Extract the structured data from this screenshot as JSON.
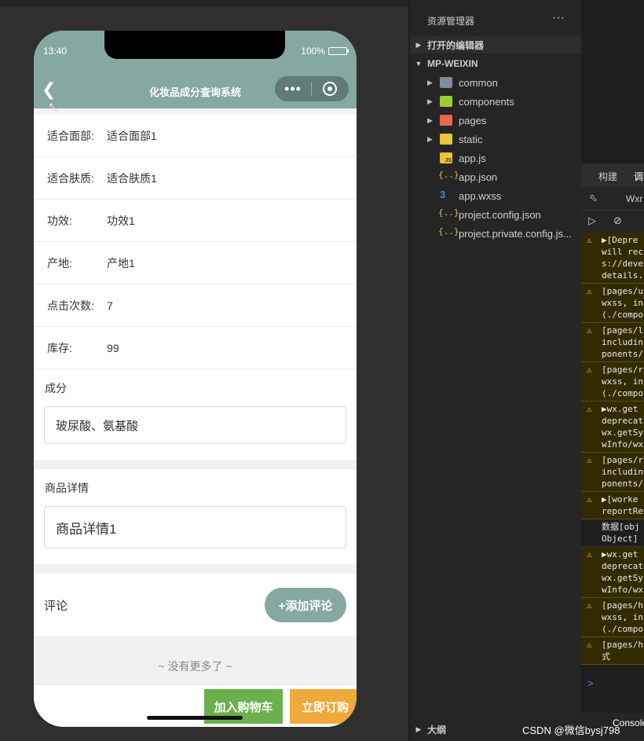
{
  "phone": {
    "time": "13:40",
    "battery": "100%",
    "battery_level": 1.0,
    "nav_title": "化妆品成分查询系统",
    "capsule_more": "•••"
  },
  "info_rows": [
    {
      "label": "适合面部:",
      "value": "适合面部1"
    },
    {
      "label": "适合肤质:",
      "value": "适合肤质1"
    },
    {
      "label": "功效:",
      "value": "功效1"
    },
    {
      "label": "产地:",
      "value": "产地1"
    },
    {
      "label": "点击次数:",
      "value": "7"
    },
    {
      "label": "库存:",
      "value": "99"
    }
  ],
  "ingredients": {
    "title": "成分",
    "value": "玻尿酸、氨基酸"
  },
  "details": {
    "title": "商品详情",
    "value": "商品详情1"
  },
  "review": {
    "label": "评论",
    "add_button": "+添加评论"
  },
  "no_more": "~ 没有更多了 ~",
  "bottom": {
    "cart": "加入购物车",
    "order": "立即订购"
  },
  "explorer": {
    "header": "资源管理器",
    "more": "···",
    "open_editors": "打开的编辑器",
    "project": "MP-WEIXIN",
    "items": [
      {
        "name": "common",
        "icon": "folder-icon",
        "expandable": true
      },
      {
        "name": "components",
        "icon": "components-folder-icon",
        "expandable": true
      },
      {
        "name": "pages",
        "icon": "pages-folder-icon",
        "expandable": true
      },
      {
        "name": "static",
        "icon": "static-folder-icon",
        "expandable": true
      },
      {
        "name": "app.js",
        "icon": "js-file-icon",
        "expandable": false
      },
      {
        "name": "app.json",
        "icon": "json-file-icon",
        "expandable": false
      },
      {
        "name": "app.wxss",
        "icon": "css-file-icon",
        "expandable": false
      },
      {
        "name": "project.config.json",
        "icon": "json-file-icon",
        "expandable": false
      },
      {
        "name": "project.private.config.js...",
        "icon": "json-file-icon",
        "expandable": false
      }
    ],
    "outline": "大纲"
  },
  "devtools": {
    "tab_build": "构建",
    "tab_debug": "调",
    "wxml_tab": "Wxr",
    "logs": [
      {
        "type": "warn",
        "lines": [
          "▶[Depre",
          "will rec",
          "s://deve",
          "details."
        ]
      },
      {
        "type": "warn",
        "lines": [
          "[pages/u",
          "wxss, in",
          "(./compo"
        ]
      },
      {
        "type": "warn",
        "lines": [
          "[pages/l",
          "includin",
          "ponents/"
        ]
      },
      {
        "type": "warn",
        "lines": [
          "[pages/r",
          "wxss, in",
          "(./compo"
        ]
      },
      {
        "type": "warn",
        "lines": [
          "▶wx.get",
          "deprecat",
          "wx.getSy",
          "wInfo/wx"
        ]
      },
      {
        "type": "warn",
        "lines": [
          "[pages/r",
          "includin",
          "ponents/"
        ]
      },
      {
        "type": "warn",
        "lines": [
          "▶[worke",
          "reportRe"
        ]
      },
      {
        "type": "log",
        "lines": [
          "数据[obj",
          "Object]"
        ]
      },
      {
        "type": "warn",
        "lines": [
          "▶wx.get",
          "deprecat",
          "wx.getSy",
          "wInfo/wx"
        ]
      },
      {
        "type": "warn",
        "lines": [
          "[pages/h",
          "wxss, in",
          "(./compo"
        ]
      },
      {
        "type": "warn",
        "lines": [
          "[pages/h",
          "式"
        ]
      }
    ],
    "prompt": ">",
    "console_tab": "Console"
  },
  "watermark": "CSDN @微信bysj798",
  "colors": {
    "theme": "#85a8a0",
    "cart": "#6ab04c",
    "order": "#f0a93b"
  }
}
